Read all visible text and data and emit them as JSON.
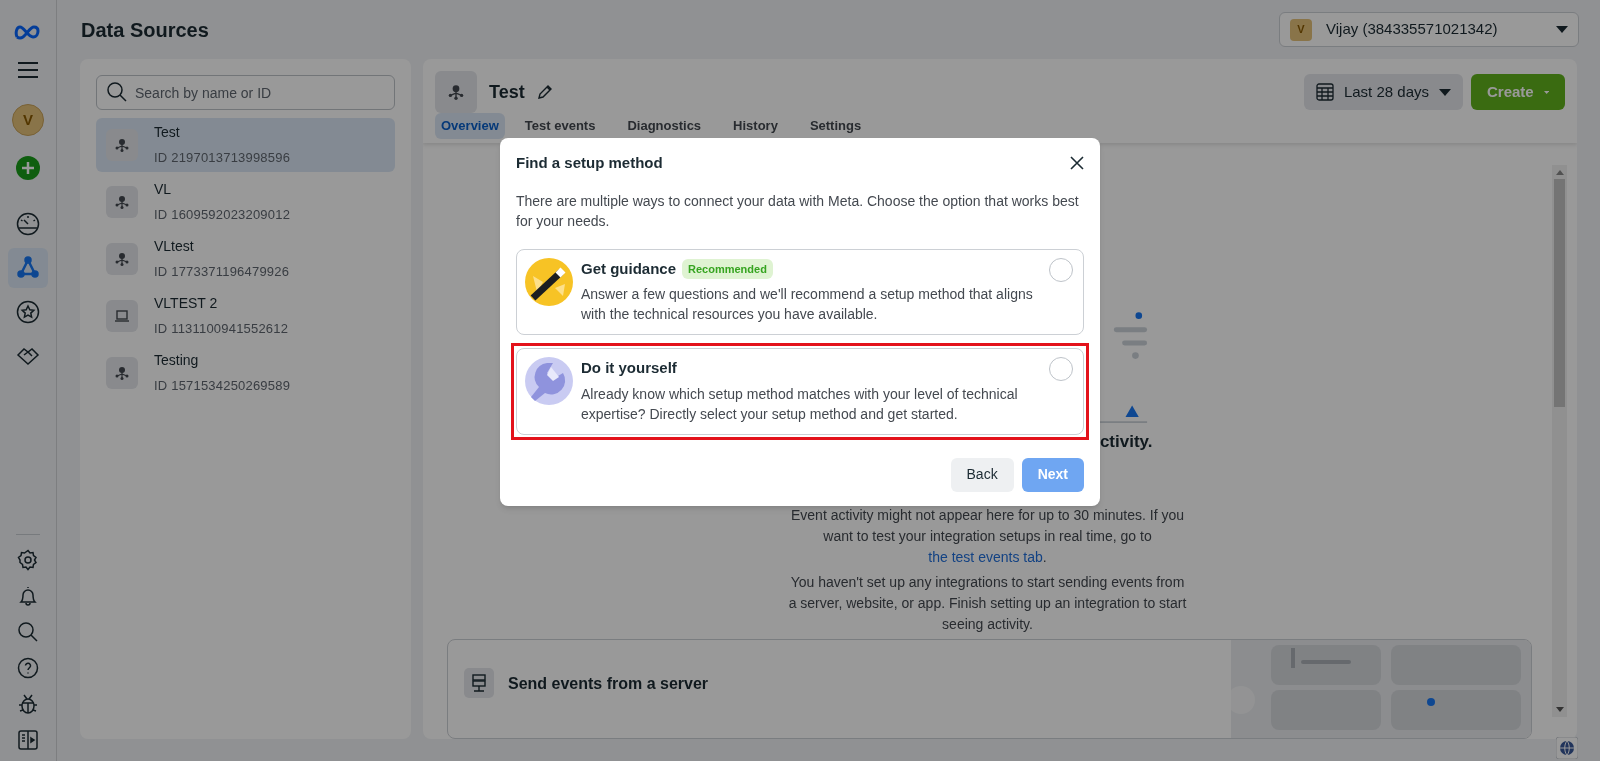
{
  "page_title": "Data Sources",
  "rail": {
    "avatar": "V",
    "items": [
      {
        "kind": "gauge",
        "selected": false
      },
      {
        "kind": "network",
        "selected": true
      },
      {
        "kind": "star",
        "selected": false
      },
      {
        "kind": "handshake",
        "selected": false
      }
    ],
    "bottom": [
      {
        "kind": "gear"
      },
      {
        "kind": "bell"
      },
      {
        "kind": "search"
      },
      {
        "kind": "help"
      },
      {
        "kind": "bug"
      },
      {
        "kind": "panel"
      }
    ]
  },
  "account": {
    "avatar": "V",
    "label": "Vijay (384335571021342)"
  },
  "search": {
    "placeholder": "Search by name or ID"
  },
  "sources": [
    {
      "name": "Test",
      "id": "ID 2197013713998596",
      "kind": "pixel",
      "selected": true
    },
    {
      "name": "VL",
      "id": "ID 1609592023209012",
      "kind": "pixel",
      "selected": false
    },
    {
      "name": "VLtest",
      "id": "ID 1773371196479926",
      "kind": "pixel",
      "selected": false
    },
    {
      "name": "VLTEST 2",
      "id": "ID 1131100941552612",
      "kind": "laptop",
      "selected": false
    },
    {
      "name": "Testing",
      "id": "ID 1571534250269589",
      "kind": "pixel",
      "selected": false
    }
  ],
  "detail": {
    "title": "Test",
    "date_range": "Last 28 days",
    "create": "Create",
    "tabs": [
      {
        "label": "Overview",
        "selected": true
      },
      {
        "label": "Test events",
        "selected": false
      },
      {
        "label": "Diagnostics",
        "selected": false
      },
      {
        "label": "History",
        "selected": false
      },
      {
        "label": "Settings",
        "selected": false
      }
    ],
    "heading": "ctivity.",
    "paragraph_1": "Event activity might not appear here for up to 30 minutes. If you want to test your integration setups in real time, go to ",
    "link": "the test events tab",
    "paragraph_1_end": ".",
    "paragraph_2": "You haven't set up any integrations to start sending events from a server, website, or app. Finish setting up an integration to start seeing activity.",
    "card_title": "Send events from a server"
  },
  "modal": {
    "title": "Find a setup method",
    "description": "There are multiple ways to connect your data with Meta. Choose the option that works best for your needs.",
    "options": [
      {
        "kind": "guidance",
        "title": "Get guidance",
        "badge": "Recommended",
        "text": "Answer a few questions and we'll recommend a setup method that aligns with the technical resources you have available.",
        "selected": false,
        "highlighted": false
      },
      {
        "kind": "diy",
        "title": "Do it yourself",
        "text": "Already know which setup method matches with your level of technical expertise? Directly select your setup method and get started.",
        "selected": false,
        "highlighted": true
      }
    ],
    "buttons": [
      {
        "label": "Back",
        "disabled": false,
        "primary": false
      },
      {
        "label": "Next",
        "disabled": true,
        "primary": true
      }
    ]
  }
}
